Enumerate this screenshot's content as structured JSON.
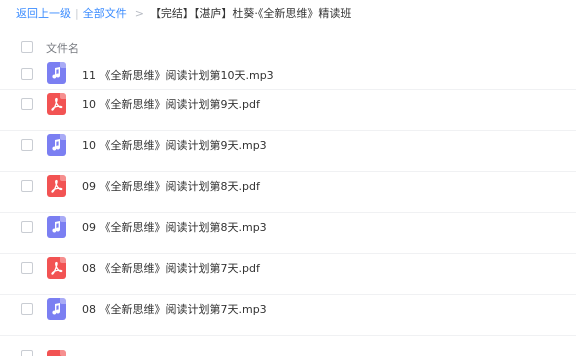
{
  "breadcrumb": {
    "back_label": "返回上一级",
    "separator": "|",
    "all_files_label": "全部文件",
    "arrow": ">",
    "current_folder": "【完结】【湛庐】杜葵·《全新思维》精读班"
  },
  "header": {
    "name_column": "文件名"
  },
  "files": [
    {
      "name": "11 《全新思维》阅读计划第10天.mp3",
      "type": "mp3",
      "icon": "audio-file-icon"
    },
    {
      "name": "10 《全新思维》阅读计划第9天.pdf",
      "type": "pdf",
      "icon": "pdf-file-icon"
    },
    {
      "name": "10 《全新思维》阅读计划第9天.mp3",
      "type": "mp3",
      "icon": "audio-file-icon"
    },
    {
      "name": "09 《全新思维》阅读计划第8天.pdf",
      "type": "pdf",
      "icon": "pdf-file-icon"
    },
    {
      "name": "09 《全新思维》阅读计划第8天.mp3",
      "type": "mp3",
      "icon": "audio-file-icon"
    },
    {
      "name": "08 《全新思维》阅读计划第7天.pdf",
      "type": "pdf",
      "icon": "pdf-file-icon"
    },
    {
      "name": "08 《全新思维》阅读计划第7天.mp3",
      "type": "mp3",
      "icon": "audio-file-icon"
    }
  ],
  "colors": {
    "link": "#3b8cff",
    "mp3_icon": "#7b7ff2",
    "pdf_icon": "#f25353",
    "text": "#333333"
  }
}
